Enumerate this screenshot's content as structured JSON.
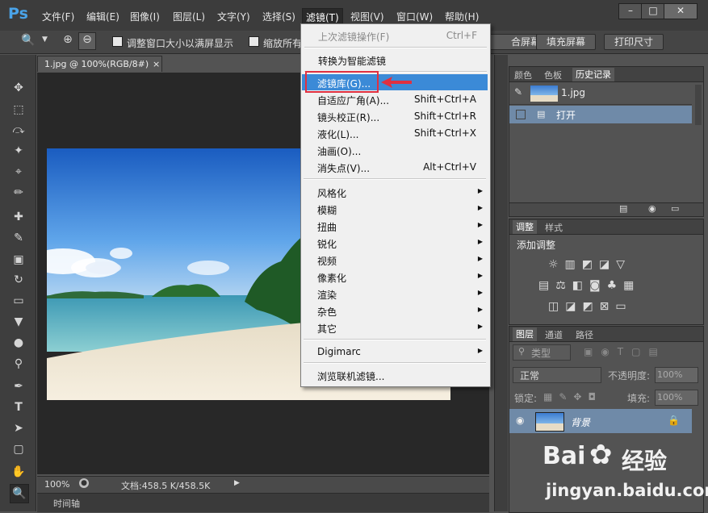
{
  "app": {
    "logo": "Ps",
    "accent": "#4aa3e8"
  },
  "menubar": {
    "items": [
      "文件(F)",
      "编辑(E)",
      "图像(I)",
      "图层(L)",
      "文字(Y)",
      "选择(S)",
      "滤镜(T)",
      "视图(V)",
      "窗口(W)",
      "帮助(H)"
    ],
    "active": "滤镜(T)",
    "window_buttons": [
      "–",
      "□",
      "✕"
    ]
  },
  "options": {
    "resize_windows": "调整窗口大小以满屏显示",
    "zoom_all": "缩放所有",
    "fit_screen": "合屏幕",
    "fill_screen": "填充屏幕",
    "print_size": "打印尺寸"
  },
  "document": {
    "tab_title": "1.jpg @ 100%(RGB/8#)",
    "tab_close": "×",
    "zoom": "100%",
    "doc_info": "文档:458.5 K/458.5K",
    "timeline": "时间轴"
  },
  "filter_menu": {
    "last_filter": "上次滤镜操作(F)",
    "last_filter_shortcut": "Ctrl+F",
    "convert_smart": "转换为智能滤镜",
    "filter_gallery": "滤镜库(G)...",
    "adaptive_wide": "自适应广角(A)...",
    "adaptive_wide_shortcut": "Shift+Ctrl+A",
    "lens_correction": "镜头校正(R)...",
    "lens_correction_shortcut": "Shift+Ctrl+R",
    "liquify": "液化(L)...",
    "liquify_shortcut": "Shift+Ctrl+X",
    "oil_paint": "油画(O)...",
    "vanishing_point": "消失点(V)...",
    "vanishing_point_shortcut": "Alt+Ctrl+V",
    "submenus": [
      "风格化",
      "模糊",
      "扭曲",
      "锐化",
      "视频",
      "像素化",
      "渲染",
      "杂色",
      "其它"
    ],
    "digimarc": "Digimarc",
    "browse_online": "浏览联机滤镜...",
    "highlight_color": "#3b8ad7",
    "callout_color": "#e03040"
  },
  "history_panel": {
    "tabs": [
      "颜色",
      "色板",
      "历史记录"
    ],
    "active_tab": "历史记录",
    "snapshot": "1.jpg",
    "step": "打开"
  },
  "adjustments_panel": {
    "tabs": [
      "调整",
      "样式"
    ],
    "active_tab": "调整",
    "title": "添加调整"
  },
  "layers_panel": {
    "tabs": [
      "图层",
      "通道",
      "路径"
    ],
    "active_tab": "图层",
    "filter_kind": "类型",
    "blend_mode": "正常",
    "opacity_label": "不透明度:",
    "opacity_value": "100%",
    "lock_label": "锁定:",
    "fill_label": "填充:",
    "fill_value": "100%",
    "layer_name": "背景"
  },
  "watermark": {
    "brand_a": "Bai",
    "brand_b": "经验",
    "url": "jingyan.baidu.com"
  }
}
